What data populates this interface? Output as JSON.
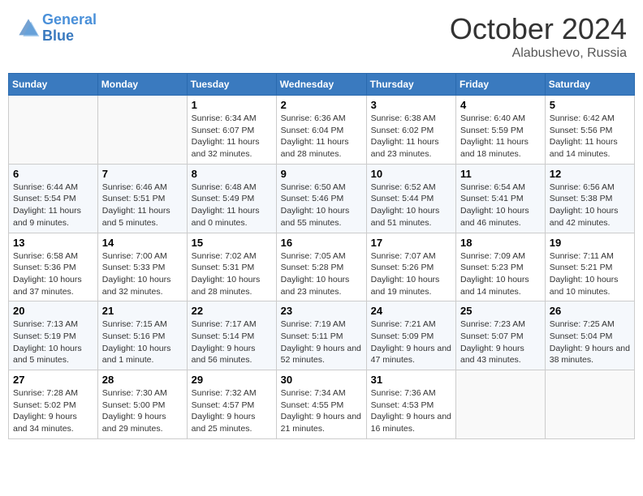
{
  "header": {
    "logo_line1": "General",
    "logo_line2": "Blue",
    "month": "October 2024",
    "location": "Alabushevo, Russia"
  },
  "days_of_week": [
    "Sunday",
    "Monday",
    "Tuesday",
    "Wednesday",
    "Thursday",
    "Friday",
    "Saturday"
  ],
  "weeks": [
    [
      {
        "day": "",
        "detail": ""
      },
      {
        "day": "",
        "detail": ""
      },
      {
        "day": "1",
        "detail": "Sunrise: 6:34 AM\nSunset: 6:07 PM\nDaylight: 11 hours and 32 minutes."
      },
      {
        "day": "2",
        "detail": "Sunrise: 6:36 AM\nSunset: 6:04 PM\nDaylight: 11 hours and 28 minutes."
      },
      {
        "day": "3",
        "detail": "Sunrise: 6:38 AM\nSunset: 6:02 PM\nDaylight: 11 hours and 23 minutes."
      },
      {
        "day": "4",
        "detail": "Sunrise: 6:40 AM\nSunset: 5:59 PM\nDaylight: 11 hours and 18 minutes."
      },
      {
        "day": "5",
        "detail": "Sunrise: 6:42 AM\nSunset: 5:56 PM\nDaylight: 11 hours and 14 minutes."
      }
    ],
    [
      {
        "day": "6",
        "detail": "Sunrise: 6:44 AM\nSunset: 5:54 PM\nDaylight: 11 hours and 9 minutes."
      },
      {
        "day": "7",
        "detail": "Sunrise: 6:46 AM\nSunset: 5:51 PM\nDaylight: 11 hours and 5 minutes."
      },
      {
        "day": "8",
        "detail": "Sunrise: 6:48 AM\nSunset: 5:49 PM\nDaylight: 11 hours and 0 minutes."
      },
      {
        "day": "9",
        "detail": "Sunrise: 6:50 AM\nSunset: 5:46 PM\nDaylight: 10 hours and 55 minutes."
      },
      {
        "day": "10",
        "detail": "Sunrise: 6:52 AM\nSunset: 5:44 PM\nDaylight: 10 hours and 51 minutes."
      },
      {
        "day": "11",
        "detail": "Sunrise: 6:54 AM\nSunset: 5:41 PM\nDaylight: 10 hours and 46 minutes."
      },
      {
        "day": "12",
        "detail": "Sunrise: 6:56 AM\nSunset: 5:38 PM\nDaylight: 10 hours and 42 minutes."
      }
    ],
    [
      {
        "day": "13",
        "detail": "Sunrise: 6:58 AM\nSunset: 5:36 PM\nDaylight: 10 hours and 37 minutes."
      },
      {
        "day": "14",
        "detail": "Sunrise: 7:00 AM\nSunset: 5:33 PM\nDaylight: 10 hours and 32 minutes."
      },
      {
        "day": "15",
        "detail": "Sunrise: 7:02 AM\nSunset: 5:31 PM\nDaylight: 10 hours and 28 minutes."
      },
      {
        "day": "16",
        "detail": "Sunrise: 7:05 AM\nSunset: 5:28 PM\nDaylight: 10 hours and 23 minutes."
      },
      {
        "day": "17",
        "detail": "Sunrise: 7:07 AM\nSunset: 5:26 PM\nDaylight: 10 hours and 19 minutes."
      },
      {
        "day": "18",
        "detail": "Sunrise: 7:09 AM\nSunset: 5:23 PM\nDaylight: 10 hours and 14 minutes."
      },
      {
        "day": "19",
        "detail": "Sunrise: 7:11 AM\nSunset: 5:21 PM\nDaylight: 10 hours and 10 minutes."
      }
    ],
    [
      {
        "day": "20",
        "detail": "Sunrise: 7:13 AM\nSunset: 5:19 PM\nDaylight: 10 hours and 5 minutes."
      },
      {
        "day": "21",
        "detail": "Sunrise: 7:15 AM\nSunset: 5:16 PM\nDaylight: 10 hours and 1 minute."
      },
      {
        "day": "22",
        "detail": "Sunrise: 7:17 AM\nSunset: 5:14 PM\nDaylight: 9 hours and 56 minutes."
      },
      {
        "day": "23",
        "detail": "Sunrise: 7:19 AM\nSunset: 5:11 PM\nDaylight: 9 hours and 52 minutes."
      },
      {
        "day": "24",
        "detail": "Sunrise: 7:21 AM\nSunset: 5:09 PM\nDaylight: 9 hours and 47 minutes."
      },
      {
        "day": "25",
        "detail": "Sunrise: 7:23 AM\nSunset: 5:07 PM\nDaylight: 9 hours and 43 minutes."
      },
      {
        "day": "26",
        "detail": "Sunrise: 7:25 AM\nSunset: 5:04 PM\nDaylight: 9 hours and 38 minutes."
      }
    ],
    [
      {
        "day": "27",
        "detail": "Sunrise: 7:28 AM\nSunset: 5:02 PM\nDaylight: 9 hours and 34 minutes."
      },
      {
        "day": "28",
        "detail": "Sunrise: 7:30 AM\nSunset: 5:00 PM\nDaylight: 9 hours and 29 minutes."
      },
      {
        "day": "29",
        "detail": "Sunrise: 7:32 AM\nSunset: 4:57 PM\nDaylight: 9 hours and 25 minutes."
      },
      {
        "day": "30",
        "detail": "Sunrise: 7:34 AM\nSunset: 4:55 PM\nDaylight: 9 hours and 21 minutes."
      },
      {
        "day": "31",
        "detail": "Sunrise: 7:36 AM\nSunset: 4:53 PM\nDaylight: 9 hours and 16 minutes."
      },
      {
        "day": "",
        "detail": ""
      },
      {
        "day": "",
        "detail": ""
      }
    ]
  ]
}
